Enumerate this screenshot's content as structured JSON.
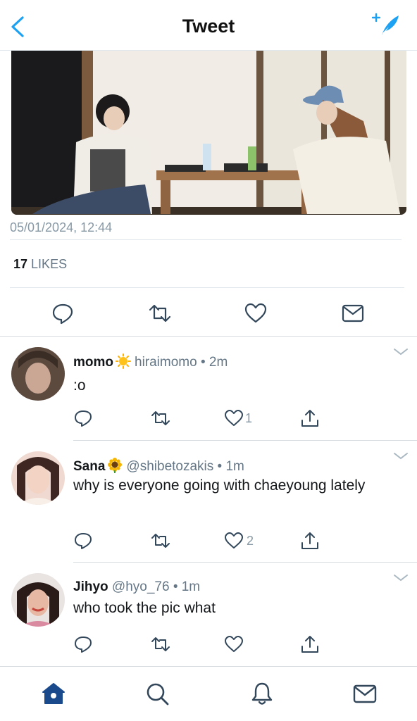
{
  "header": {
    "title": "Tweet",
    "back_icon": "chevron-left-icon",
    "compose_icon": "compose-tweet-icon"
  },
  "tweet": {
    "timestamp": "05/01/2024, 12:44",
    "likes_count": "17",
    "likes_label": "LIKES",
    "actions": [
      "reply-icon",
      "retweet-icon",
      "like-icon",
      "direct-message-icon"
    ]
  },
  "replies": [
    {
      "name": "momo",
      "emoji": "sun-emoji",
      "handle": "hiraimomo",
      "time": "• 2m",
      "text": ":o",
      "like_count": "1"
    },
    {
      "name": "Sana",
      "emoji": "sunflower-emoji",
      "handle": "@shibetozakis",
      "time": "• 1m",
      "text": "why is everyone going with chaeyoung lately",
      "like_count": "2"
    },
    {
      "name": "Jihyo",
      "emoji": "",
      "handle": "@hyo_76",
      "time": "• 1m",
      "text": "who took the pic what",
      "like_count": ""
    }
  ],
  "tabbar": {
    "tabs": [
      "home-icon",
      "search-icon",
      "notifications-icon",
      "messages-icon"
    ],
    "active": "home-icon"
  },
  "colors": {
    "accent": "#1da1f2",
    "home_active": "#1b4a8c",
    "secondary_text": "#657786",
    "divider": "#e1e8ed"
  }
}
